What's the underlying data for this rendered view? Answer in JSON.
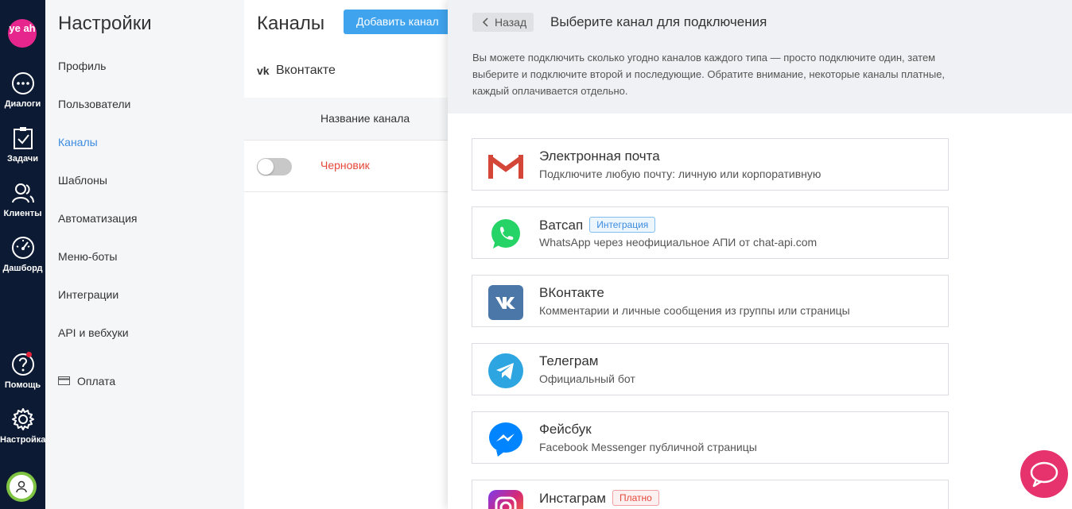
{
  "nav": {
    "logo_text": "ye ah",
    "items": [
      {
        "label": "Диалоги",
        "icon": "chat-bubble-icon"
      },
      {
        "label": "Задачи",
        "icon": "tasks-icon"
      },
      {
        "label": "Клиенты",
        "icon": "clients-icon"
      },
      {
        "label": "Дашборд",
        "icon": "dashboard-icon"
      },
      {
        "label": "Помощь",
        "icon": "help-icon"
      },
      {
        "label": "Настройка",
        "icon": "gear-icon"
      }
    ]
  },
  "settings": {
    "title": "Настройки",
    "items": [
      "Профиль",
      "Пользователи",
      "Каналы",
      "Шаблоны",
      "Автоматизация",
      "Меню-боты",
      "Интеграции",
      "API и вебхуки"
    ],
    "active": "Каналы",
    "payment": "Оплата"
  },
  "main": {
    "title": "Каналы",
    "add_button": "Добавить канал",
    "vk_mark": "vk",
    "section": "Вконтакте",
    "column_name": "Название канала",
    "row_status": "Черновик"
  },
  "panel": {
    "back": "Назад",
    "title": "Выберите канал для подключения",
    "description": "Вы можете подключить сколько угодно каналов каждого типа — просто подключите один, затем выберите и подключите второй и последующие. Обратите внимание, некоторые каналы платные, каждый оплачивается отдельно.",
    "channels": [
      {
        "title": "Электронная почта",
        "subtitle": "Подключите любую почту: личную или корпоративную",
        "icon": "gmail-icon"
      },
      {
        "title": "Ватсап",
        "badge": "Интеграция",
        "subtitle": "WhatsApp через неофициальное АПИ от chat-api.com",
        "icon": "whatsapp-icon"
      },
      {
        "title": "ВКонтакте",
        "subtitle": "Комментарии и личные сообщения из группы или страницы",
        "icon": "vk-icon"
      },
      {
        "title": "Телеграм",
        "subtitle": "Официальный бот",
        "icon": "telegram-icon"
      },
      {
        "title": "Фейсбук",
        "subtitle": "Facebook Messenger публичной страницы",
        "icon": "messenger-icon"
      },
      {
        "title": "Инстаграм",
        "badge": "Платно",
        "subtitle": "",
        "icon": "instagram-icon"
      }
    ]
  },
  "colors": {
    "nav_bg": "#0c1b33",
    "accent_blue": "#40a3ee",
    "brand_pink": "#e6268c",
    "danger_red": "#e5483a"
  }
}
